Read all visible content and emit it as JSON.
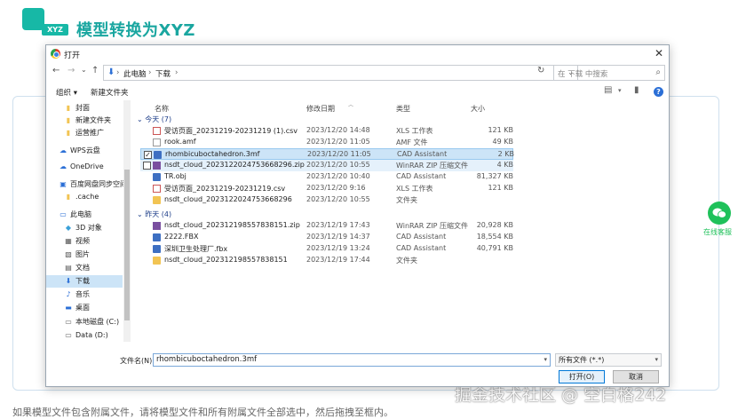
{
  "page": {
    "logo_tag": "XYZ",
    "title": "模型转换为XYZ",
    "hint": "如果模型文件包含附属文件，请将模型文件和所有附属文件全部选中，然后拖拽至框内。",
    "watermark": "掘金技术社区 @ 空白格242",
    "wechat_label": "在线客服"
  },
  "dialog": {
    "title": "打开",
    "close_glyph": "✕",
    "nav": {
      "back": "←",
      "forward": "→",
      "recent": "⌄",
      "up": "↑",
      "refresh": "↻"
    },
    "breadcrumb": [
      "此电脑",
      "下载"
    ],
    "breadcrumb_sep": "›",
    "search_placeholder": "在 下载 中搜索",
    "toolbar": {
      "organize": "组织 ▾",
      "new_folder": "新建文件夹"
    },
    "sidebar": [
      {
        "label": "封面",
        "icon": "folder-icon"
      },
      {
        "label": "新建文件夹",
        "icon": "folder-icon"
      },
      {
        "label": "运营推广",
        "icon": "folder-icon"
      },
      {
        "label": "WPS云盘",
        "icon": "cloud-icon"
      },
      {
        "label": "OneDrive",
        "icon": "cloud-icon"
      },
      {
        "label": "百度网盘同步空间",
        "icon": "baidu-icon"
      },
      {
        "label": ".cache",
        "icon": "folder-icon"
      },
      {
        "label": "此电脑",
        "icon": "computer-icon"
      },
      {
        "label": "3D 对象",
        "icon": "cube-icon"
      },
      {
        "label": "视频",
        "icon": "video-icon"
      },
      {
        "label": "图片",
        "icon": "picture-icon"
      },
      {
        "label": "文档",
        "icon": "document-icon"
      },
      {
        "label": "下载",
        "icon": "download-icon",
        "selected": true
      },
      {
        "label": "音乐",
        "icon": "music-icon"
      },
      {
        "label": "桌面",
        "icon": "desktop-icon"
      },
      {
        "label": "本地磁盘 (C:)",
        "icon": "drive-icon"
      },
      {
        "label": "Data (D:)",
        "icon": "drive-icon"
      }
    ],
    "columns": {
      "name": "名称",
      "date": "修改日期",
      "type": "类型",
      "size": "大小"
    },
    "groups": [
      {
        "label": "今天 (7)",
        "files": [
          {
            "name": "受访页面_20231219-20231219 (1).csv",
            "date": "2023/12/20 14:48",
            "type": "XLS 工作表",
            "size": "121 KB",
            "icon": "csv"
          },
          {
            "name": "rook.amf",
            "date": "2023/12/20 11:05",
            "type": "AMF 文件",
            "size": "49 KB",
            "icon": "txt"
          },
          {
            "name": "rhombicuboctahedron.3mf",
            "date": "2023/12/20 11:05",
            "type": "CAD Assistant",
            "size": "2 KB",
            "icon": "cad",
            "state": "selected",
            "checked": true
          },
          {
            "name": "nsdt_cloud_2023122024753668296.zip",
            "date": "2023/12/20 10:55",
            "type": "WinRAR ZIP 压缩文件",
            "size": "4 KB",
            "icon": "zip",
            "state": "hover",
            "checked": false
          },
          {
            "name": "TR.obj",
            "date": "2023/12/20 10:40",
            "type": "CAD Assistant",
            "size": "81,327 KB",
            "icon": "cad"
          },
          {
            "name": "受访页面_20231219-20231219.csv",
            "date": "2023/12/20 9:16",
            "type": "XLS 工作表",
            "size": "121 KB",
            "icon": "csv"
          },
          {
            "name": "nsdt_cloud_2023122024753668296",
            "date": "2023/12/20 10:55",
            "type": "文件夹",
            "size": "",
            "icon": "folder"
          }
        ]
      },
      {
        "label": "昨天 (4)",
        "files": [
          {
            "name": "nsdt_cloud_202312198557838151.zip",
            "date": "2023/12/19 17:43",
            "type": "WinRAR ZIP 压缩文件",
            "size": "20,928 KB",
            "icon": "zip"
          },
          {
            "name": "2222.FBX",
            "date": "2023/12/19 14:37",
            "type": "CAD Assistant",
            "size": "18,554 KB",
            "icon": "cad"
          },
          {
            "name": "深圳卫生处理厂.fbx",
            "date": "2023/12/19 13:24",
            "type": "CAD Assistant",
            "size": "40,791 KB",
            "icon": "cad"
          },
          {
            "name": "nsdt_cloud_202312198557838151",
            "date": "2023/12/19 17:44",
            "type": "文件夹",
            "size": "",
            "icon": "folder"
          }
        ]
      }
    ],
    "filename_label": "文件名(N):",
    "filename_value": "rhombicuboctahedron.3mf",
    "filter": "所有文件 (*.*)",
    "open_button": "打开(O)",
    "cancel_button": "取消"
  }
}
